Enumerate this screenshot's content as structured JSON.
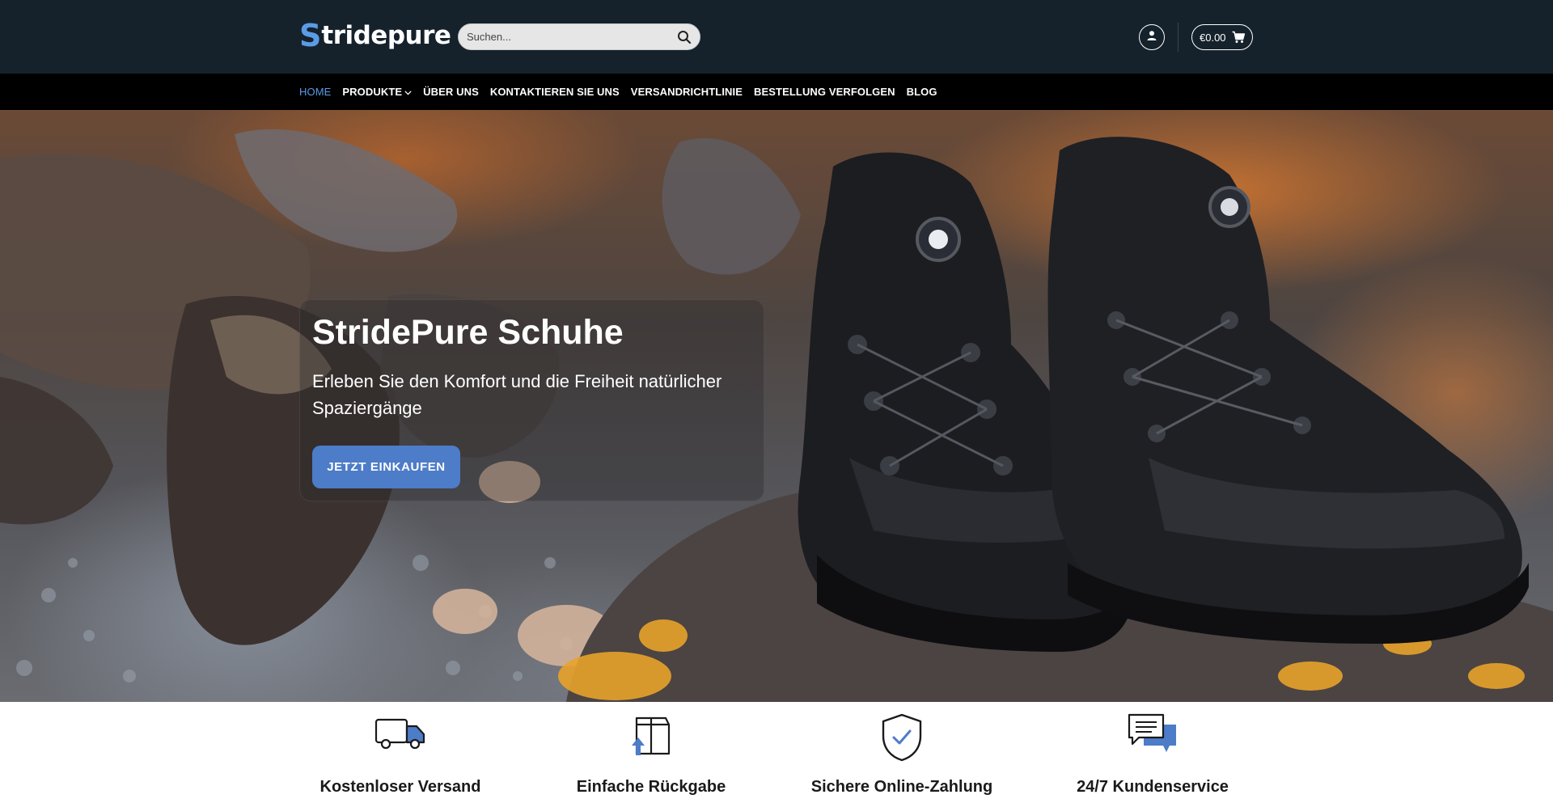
{
  "header": {
    "logo": {
      "first_letter": "S",
      "rest": "tridepure"
    },
    "search": {
      "placeholder": "Suchen..."
    },
    "cart": {
      "total": "€0.00"
    },
    "icons": {
      "search": "search-icon",
      "account": "user-icon",
      "cart": "cart-icon"
    }
  },
  "nav": {
    "items": [
      {
        "label": "HOME",
        "active": true
      },
      {
        "label": "PRODUKTE",
        "has_dropdown": true
      },
      {
        "label": "ÜBER UNS"
      },
      {
        "label": "KONTAKTIEREN SIE UNS"
      },
      {
        "label": "VERSANDRICHTLINIE"
      },
      {
        "label": "BESTELLUNG VERFOLGEN"
      },
      {
        "label": "BLOG"
      }
    ]
  },
  "hero": {
    "title": "StridePure Schuhe",
    "subtitle": "Erleben Sie den Komfort und die Freiheit natürlicher Spaziergänge",
    "cta": "JETZT EINKAUFEN"
  },
  "features": [
    {
      "label": "Kostenloser Versand",
      "icon": "truck-icon"
    },
    {
      "label": "Einfache Rückgabe",
      "icon": "return-box-icon"
    },
    {
      "label": "Sichere Online-Zahlung",
      "icon": "shield-check-icon"
    },
    {
      "label": "24/7 Kundenservice",
      "icon": "chat-icon"
    }
  ],
  "colors": {
    "header_bg": "#15222c",
    "nav_bg": "#000000",
    "accent": "#5b9be6",
    "button": "#4d7cc8"
  }
}
